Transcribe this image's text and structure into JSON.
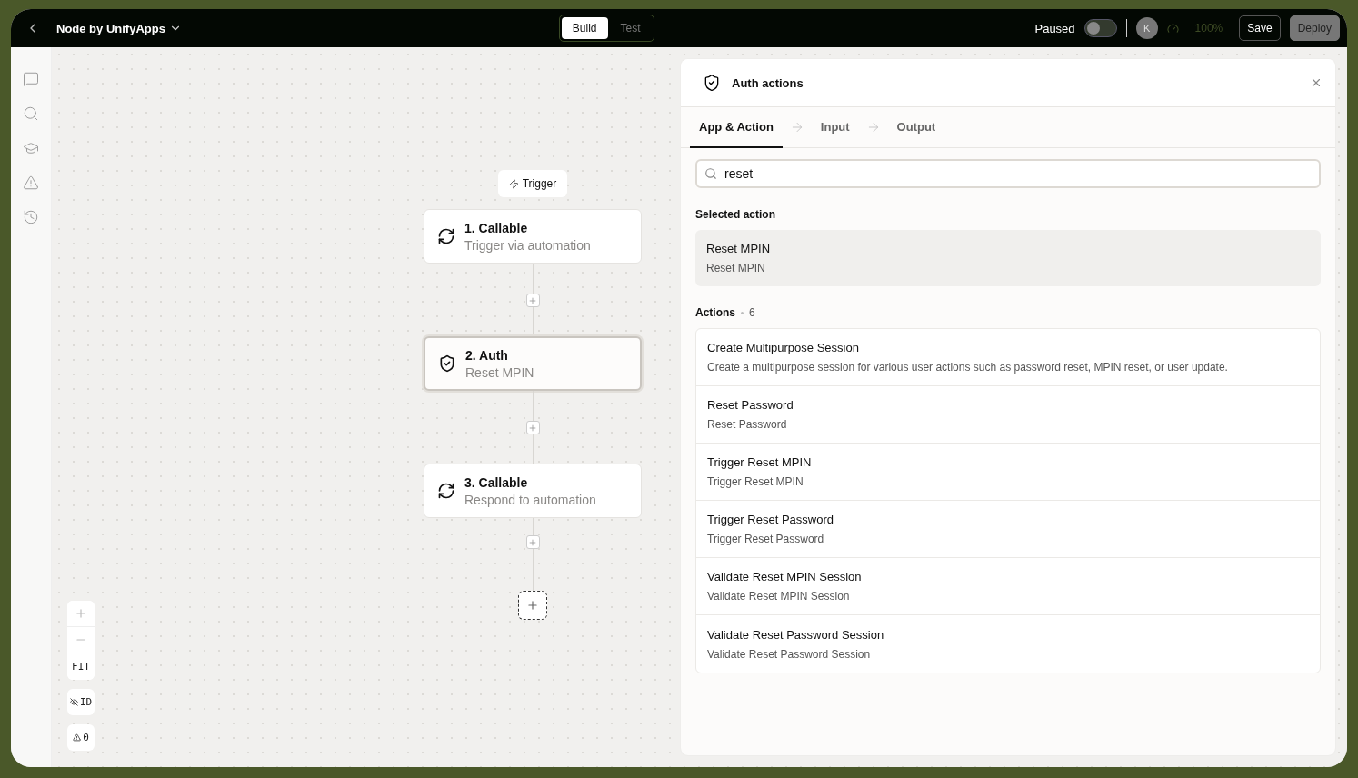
{
  "header": {
    "title": "Node by UnifyApps",
    "mode_tabs": [
      {
        "label": "Build",
        "selected": true
      },
      {
        "label": "Test",
        "selected": false
      }
    ],
    "status_label": "Paused",
    "paused_toggle": {
      "on": false
    },
    "avatar": "K",
    "zoom": "100%",
    "buttons": [
      {
        "label": "Save",
        "disabled": false
      },
      {
        "label": "Deploy",
        "disabled": true
      }
    ]
  },
  "flow": {
    "trigger": "Trigger",
    "steps": [
      {
        "title": "1. Callable",
        "subtitle": "Trigger via automation",
        "kind": "callable",
        "selected": false
      },
      {
        "title": "2. Auth",
        "subtitle": "Reset MPIN",
        "kind": "auth",
        "selected": true
      },
      {
        "title": "3. Callable",
        "subtitle": "Respond to automation",
        "kind": "callable",
        "selected": false
      }
    ]
  },
  "canvas_controls": {
    "fit": "FIT",
    "id_toggle": "ID",
    "warnings": "0"
  },
  "panel": {
    "title": "Auth actions",
    "tabs": [
      {
        "label": "App & Action",
        "selected": true
      },
      {
        "label": "Input",
        "selected": false
      },
      {
        "label": "Output",
        "selected": false
      }
    ],
    "search": {
      "value": "reset"
    },
    "selected_label": "Selected action",
    "selected_action": {
      "title": "Reset MPIN",
      "description": "Reset MPIN"
    },
    "actions_label": "Actions",
    "actions_count": "6",
    "actions": [
      {
        "title": "Create Multipurpose Session",
        "description": "Create a multipurpose session for various user actions such as password reset, MPIN reset, or user update."
      },
      {
        "title": "Reset Password",
        "description": "Reset Password"
      },
      {
        "title": "Trigger Reset MPIN",
        "description": "Trigger Reset MPIN"
      },
      {
        "title": "Trigger Reset Password",
        "description": "Trigger Reset Password"
      },
      {
        "title": "Validate Reset MPIN Session",
        "description": "Validate Reset MPIN Session"
      },
      {
        "title": "Validate Reset Password Session",
        "description": "Validate Reset Password Session"
      }
    ]
  }
}
